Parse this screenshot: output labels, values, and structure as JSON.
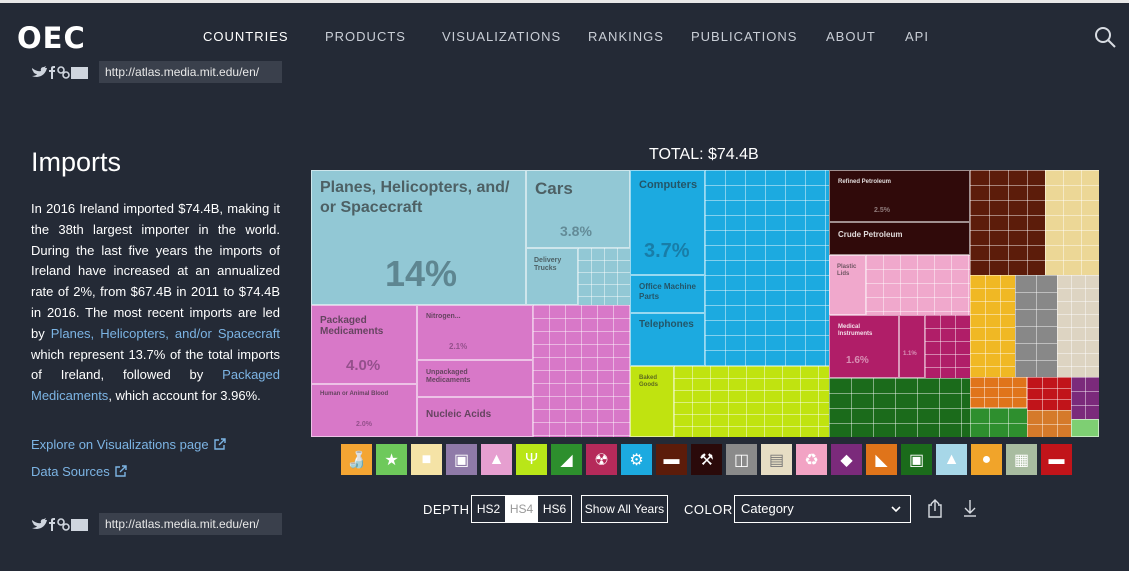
{
  "nav": {
    "logo": "OEC",
    "items": [
      "COUNTRIES",
      "PRODUCTS",
      "VISUALIZATIONS",
      "RANKINGS",
      "PUBLICATIONS",
      "ABOUT",
      "API"
    ],
    "search_icon": "search-icon"
  },
  "share": {
    "url": "http://atlas.media.mit.edu/en/",
    "icons": [
      "twitter-icon",
      "facebook-icon",
      "link-icon",
      "image-icon"
    ]
  },
  "section": {
    "heading": "Imports",
    "p1": "In 2016 Ireland imported $74.4B, making it the 38th largest importer in the world. During the last five years the imports of Ireland have increased at an annualized rate of 2%, from $67.4B in 2011 to $74.4B in 2016. The most recent imports are led by ",
    "link1": "Planes, Helicopters, and/or Spacecraft",
    "p2": " which represent 13.7% of the total imports of Ireland, followed by ",
    "link2": "Packaged Medicaments",
    "p3": ", which account for 3.96%.",
    "explore_link": "Explore on Visualizations page",
    "sources_link": "Data Sources"
  },
  "treemap": {
    "total": "TOTAL: $74.4B",
    "labels": {
      "planes": "Planes, Helicopters, and/ or Spacecraft",
      "planes_pct": "14%",
      "cars": "Cars",
      "cars_pct": "3.8%",
      "delivery": "Delivery Trucks",
      "packaged": "Packaged Medicaments",
      "packaged_pct": "4.0%",
      "nitrogen": "Nitrogen...",
      "nitrogen_pct": "2.1%",
      "unpackaged": "Unpackaged Medicaments",
      "human": "Human or Animal Blood",
      "human_pct": "2.0%",
      "nucleic": "Nucleic Acids",
      "computers": "Computers",
      "computers_pct": "3.7%",
      "office": "Office Machine Parts",
      "telephones": "Telephones",
      "baked": "Baked Goods",
      "refined": "Refined Petroleum",
      "refined_pct": "2.5%",
      "crude": "Crude Petroleum",
      "plastic": "Plastic Lids",
      "medical": "Medical Instruments",
      "medical_pct": "1.6%",
      "medical_pct2": "1.1%"
    }
  },
  "categories": [
    {
      "icon": "bottle-icon",
      "color": "#f4a533"
    },
    {
      "icon": "animal-hide-icon",
      "color": "#6ec95b"
    },
    {
      "icon": "animal-icon",
      "color": "#f5e3a6"
    },
    {
      "icon": "frame-icon",
      "color": "#8f7aa8"
    },
    {
      "icon": "flask-icon",
      "color": "#e69fd0"
    },
    {
      "icon": "wheat-icon",
      "color": "#b9e618"
    },
    {
      "icon": "shoe-icon",
      "color": "#2d8f2d"
    },
    {
      "icon": "radiation-icon",
      "color": "#b52a5a"
    },
    {
      "icon": "gears-icon",
      "color": "#1caae0"
    },
    {
      "icon": "anvil-icon",
      "color": "#5c1c0a"
    },
    {
      "icon": "pickaxe-icon",
      "color": "#2a0a0a"
    },
    {
      "icon": "box-icon",
      "color": "#8a8a8a"
    },
    {
      "icon": "paper-icon",
      "color": "#e6ddc4"
    },
    {
      "icon": "recycle-icon",
      "color": "#f2a3c4"
    },
    {
      "icon": "diamond-icon",
      "color": "#7b2a7b"
    },
    {
      "icon": "stone-icon",
      "color": "#e0741a"
    },
    {
      "icon": "shirt-icon",
      "color": "#1b6b1b"
    },
    {
      "icon": "road-icon",
      "color": "#a7d7e8"
    },
    {
      "icon": "fruit-icon",
      "color": "#f1a42a"
    },
    {
      "icon": "building-icon",
      "color": "#a8bca0"
    },
    {
      "icon": "weapon-icon",
      "color": "#c1141a"
    }
  ],
  "controls": {
    "depth_label": "DEPTH",
    "depth_options": [
      "HS2",
      "HS4",
      "HS6"
    ],
    "depth_selected": "HS4",
    "all_years": "Show All Years",
    "color_label": "COLOR",
    "color_value": "Category"
  }
}
